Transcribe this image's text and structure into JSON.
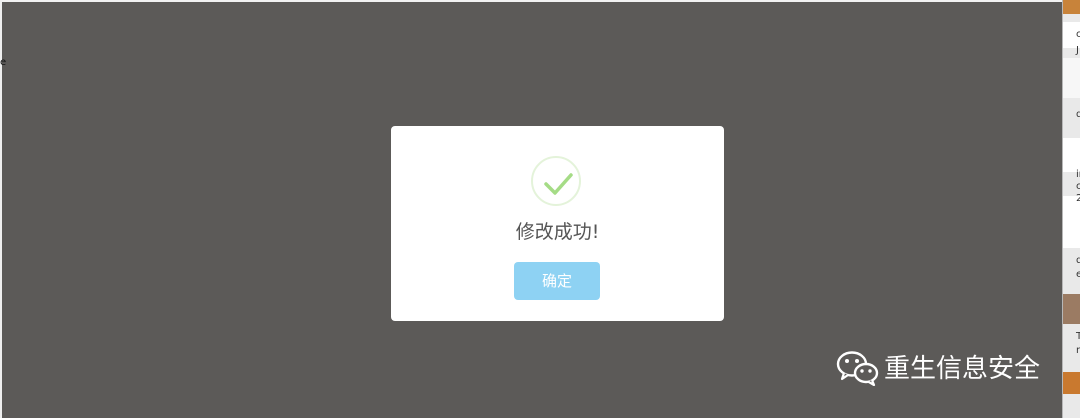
{
  "dialog": {
    "message": "修改成功!",
    "confirm_label": "确定",
    "icon": "success-check-icon",
    "accent_color": "#8ed2f3",
    "check_color": "#a5dc86"
  },
  "overlay": {
    "color": "#5c5a58"
  },
  "edge_text": {
    "left": "e"
  },
  "right_strip": {
    "chars": [
      "c",
      "J",
      "q",
      "ir",
      "c",
      "2",
      "d",
      "e",
      "T",
      "r"
    ]
  },
  "watermark": {
    "text": "重生信息安全",
    "icon": "wechat-icon"
  }
}
